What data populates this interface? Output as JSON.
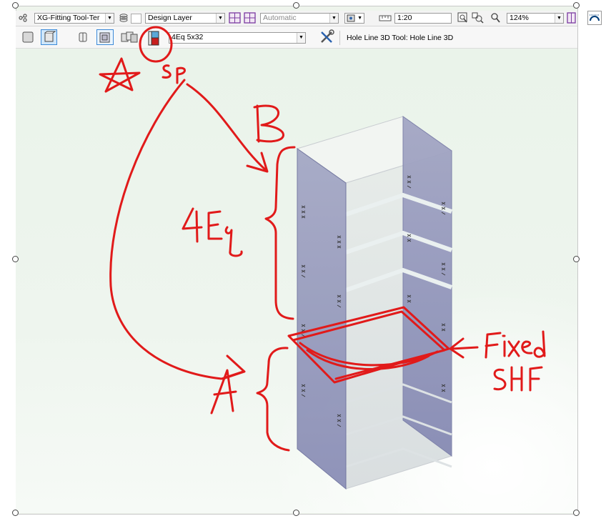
{
  "toolbar": {
    "class_dropdown": "XG-Fitting Tool-Ter",
    "layer_dropdown": "Design Layer",
    "render_dropdown": "Automatic",
    "scale_value": "1:20",
    "zoom_value": "124%"
  },
  "tool_bar": {
    "preset_dropdown": "4Eq 5x32",
    "tool_status": "Hole Line 3D Tool: Hole Line 3D"
  },
  "annotations": {
    "label_sp": "sp",
    "label_b": "B",
    "label_4eq": "4Eq",
    "label_a": "A",
    "label_fixed": "Fixed",
    "label_shf": "SHF"
  },
  "colors": {
    "canvas_bg": "#eef4ec",
    "panel": "#9aa0c8",
    "ink": "#e11a1a"
  }
}
